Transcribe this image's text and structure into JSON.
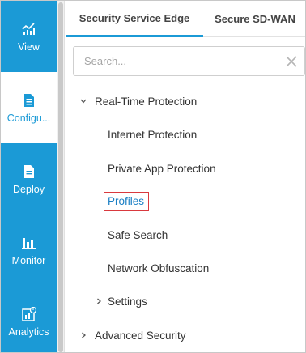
{
  "colors": {
    "rail": "#1b9ad6",
    "accent": "#1b9ad6",
    "highlight_border": "#d9393e",
    "link": "#1b7fc4"
  },
  "rail": {
    "items": [
      {
        "label": "View",
        "icon": "line-chart-icon"
      },
      {
        "label": "Configu...",
        "icon": "document-icon",
        "active": true
      },
      {
        "label": "Deploy",
        "icon": "document-icon"
      },
      {
        "label": "Monitor",
        "icon": "bar-chart-icon"
      },
      {
        "label": "Analytics",
        "icon": "analytics-icon"
      }
    ]
  },
  "tabs": [
    {
      "label": "Security Service Edge",
      "active": true
    },
    {
      "label": "Secure SD-WAN",
      "active": false
    }
  ],
  "search": {
    "placeholder": "Search...",
    "value": ""
  },
  "tree": {
    "rtp": {
      "label": "Real-Time Protection",
      "expanded": true
    },
    "rtp_children": [
      {
        "label": "Internet Protection"
      },
      {
        "label": "Private App Protection"
      },
      {
        "label": "Profiles",
        "selected": true
      },
      {
        "label": "Safe Search"
      },
      {
        "label": "Network Obfuscation"
      }
    ],
    "settings": {
      "label": "Settings",
      "expanded": false
    },
    "advanced": {
      "label": "Advanced Security",
      "expanded": false
    }
  }
}
